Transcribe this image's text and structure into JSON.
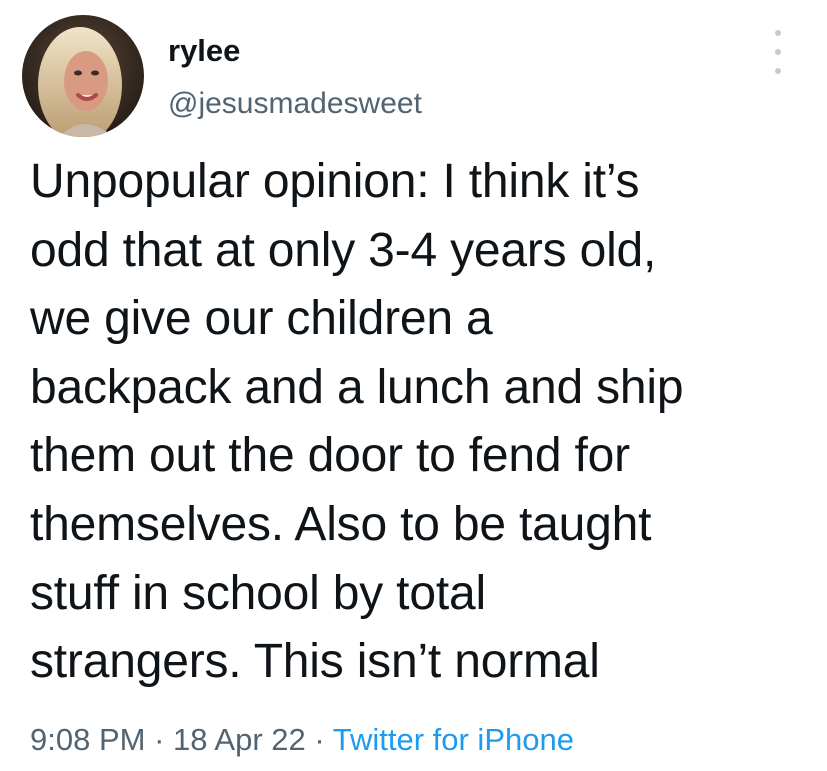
{
  "user": {
    "display_name": "rylee",
    "handle": "@jesusmadesweet"
  },
  "tweet": {
    "text": "Unpopular opinion: I think it’s\nodd that at only 3-4 years old,\nwe give our children a\nbackpack and a lunch and ship\nthem out the door to fend for\nthemselves. Also to be taught\nstuff in school by total\nstrangers. This isn’t normal",
    "time": "9:08 PM",
    "separator": " · ",
    "date": "18 Apr 22",
    "source": "Twitter for iPhone"
  },
  "icons": {
    "more": "more-vertical-icon"
  },
  "colors": {
    "text": "#0f1419",
    "secondary": "#536471",
    "link": "#1d9bf0"
  }
}
